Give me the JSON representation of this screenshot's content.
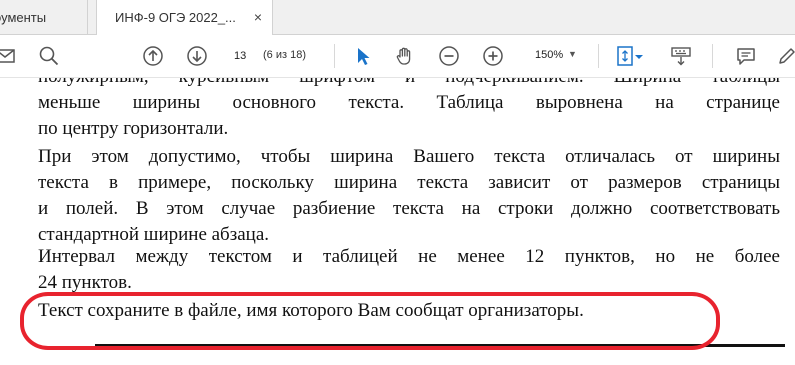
{
  "tabs": {
    "prev_label": "оументы",
    "active_label": "ИНФ-9 ОГЭ 2022_...",
    "close_glyph": "×"
  },
  "toolbar": {
    "page_current": "13",
    "page_count": "(6 из 18)",
    "zoom": "150%",
    "zoom_arrow": "▼",
    "accent_color": "#1a73c9"
  },
  "document": {
    "clipped_line": "полужирным, курсивным шрифтом и подчеркиванием. Ширина таблицы",
    "paragraph1_lines": [
      "меньше ширины основного текста. Таблица выровнена на странице",
      "по центру горизонтали."
    ],
    "paragraph2_lines": [
      "При этом допустимо, чтобы ширина Вашего текста отличалась от ширины",
      "текста в примере, поскольку ширина текста зависит от размеров страницы",
      "и полей. В этом случае разбиение текста на строки должно соответствовать",
      "стандартной ширине абзаца."
    ],
    "paragraph3_lines": [
      "Интервал между текстом и таблицей не менее 12 пунктов, но не более",
      "24 пунктов."
    ],
    "paragraph4": "Текст сохраните в файле, имя которого Вам сообщат организаторы.",
    "highlight_color": "#e8232e"
  }
}
